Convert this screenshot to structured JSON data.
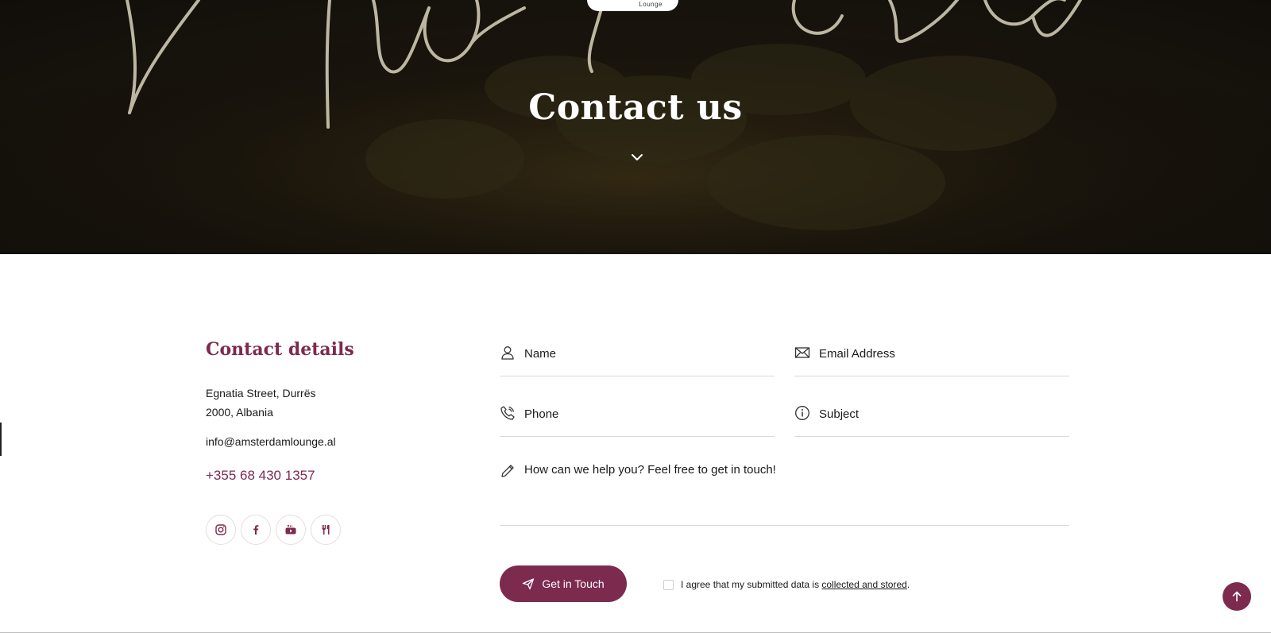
{
  "hero": {
    "title": "Contact us",
    "logo_text": "Lounge",
    "chevron_icon": "chevron-down-icon"
  },
  "details": {
    "title": "Contact details",
    "address_line1": "Egnatia Street, Durrës",
    "address_line2": "2000, Albania",
    "email": "info@amsterdamlounge.al",
    "phone": "+355 68 430 1357",
    "socials": [
      {
        "icon": "instagram-icon"
      },
      {
        "icon": "facebook-icon"
      },
      {
        "icon": "youtube-icon"
      },
      {
        "icon": "restaurant-icon"
      }
    ]
  },
  "form": {
    "name_placeholder": "Name",
    "email_placeholder": "Email Address",
    "phone_placeholder": "Phone",
    "subject_placeholder": "Subject",
    "message_placeholder": "How can we help you? Feel free to get in touch!",
    "submit_label": "Get in Touch",
    "consent_text": "I agree that my submitted data is ",
    "consent_link": "collected and stored",
    "consent_end": "."
  },
  "colors": {
    "accent": "#7d2a4f",
    "hero_bg": "#15110c"
  }
}
